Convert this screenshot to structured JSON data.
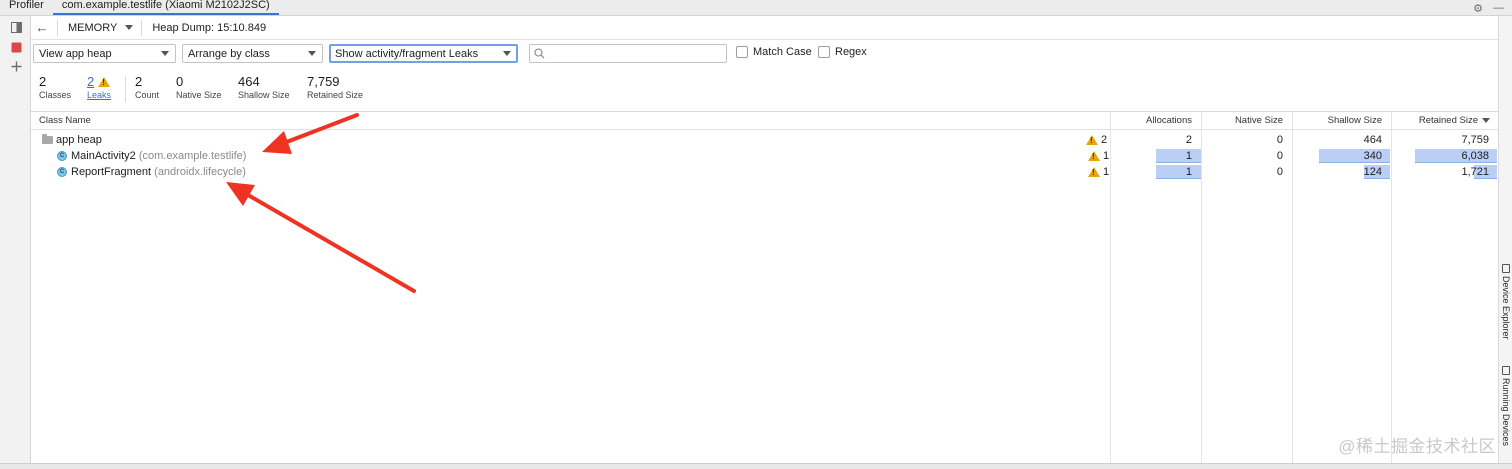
{
  "tabs": [
    {
      "label": "Profiler",
      "active": false
    },
    {
      "label": "com.example.testlife (Xiaomi M2102J2SC)",
      "active": true
    }
  ],
  "toolbar": {
    "profiler_type": "MEMORY",
    "heap_dump_label": "Heap Dump: 15:10.849"
  },
  "filters": {
    "heap": "View app heap",
    "arrange": "Arrange by class",
    "leaks_filter": "Show activity/fragment Leaks",
    "search_placeholder": "",
    "match_case": "Match Case",
    "regex": "Regex"
  },
  "stats": [
    {
      "value": "2",
      "label": "Classes"
    },
    {
      "value": "2",
      "label": "Leaks",
      "link": true
    },
    {
      "value": "2",
      "label": "Count"
    },
    {
      "value": "0",
      "label": "Native Size"
    },
    {
      "value": "464",
      "label": "Shallow Size"
    },
    {
      "value": "7,759",
      "label": "Retained Size"
    }
  ],
  "table": {
    "columns": [
      "Class Name",
      "Allocations",
      "Native Size",
      "Shallow Size",
      "Retained Size"
    ],
    "rows": [
      {
        "name": "app heap",
        "package": "",
        "leaks": "2",
        "allocations": "2",
        "native": "0",
        "shallow": "464",
        "retained": "7,759",
        "shallow_fraction": 1.0,
        "retained_fraction": 1.0
      },
      {
        "name": "MainActivity2",
        "package": "(com.example.testlife)",
        "leaks": "1",
        "allocations": "1",
        "native": "0",
        "shallow": "340",
        "retained": "6,038",
        "shallow_fraction": 0.733,
        "retained_fraction": 0.778
      },
      {
        "name": "ReportFragment",
        "package": "(androidx.lifecycle)",
        "leaks": "1",
        "allocations": "1",
        "native": "0",
        "shallow": "124",
        "retained": "1,721",
        "shallow_fraction": 0.267,
        "retained_fraction": 0.222
      }
    ]
  },
  "side_tools": [
    "Device Explorer",
    "Running Devices"
  ],
  "watermark": "@稀土掘金技术社区",
  "colors": {
    "accent": "#3874d8",
    "warning": "#e8a60d",
    "bar_fill": "#b9cff3",
    "annotation_arrow": "#ee3322"
  }
}
